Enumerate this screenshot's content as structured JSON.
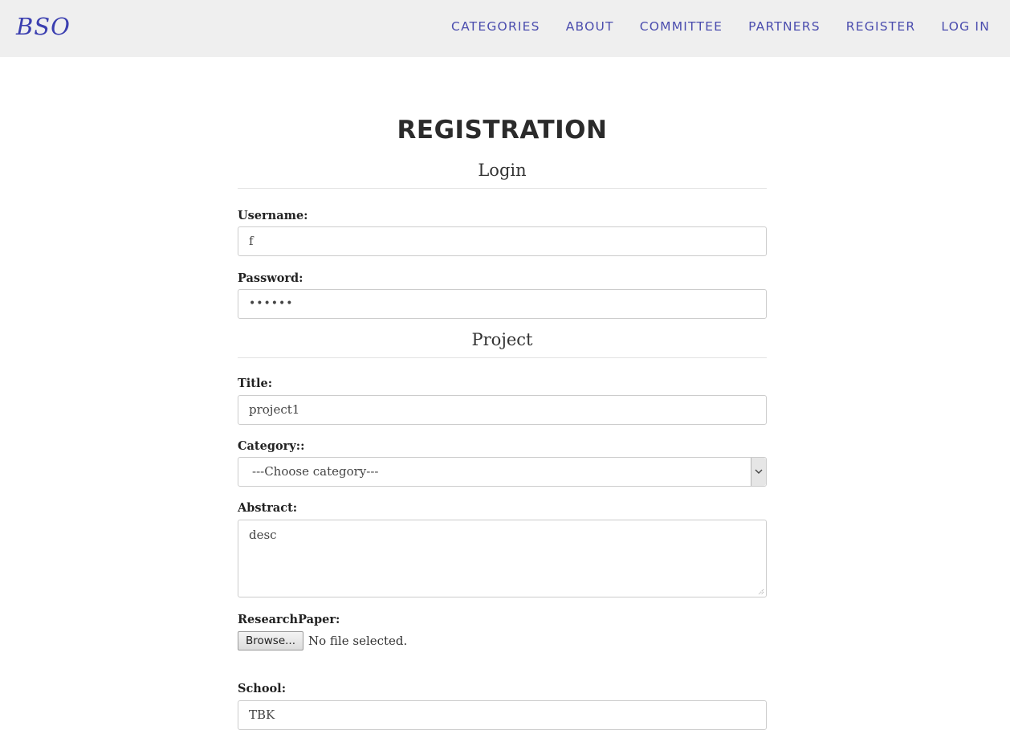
{
  "brand": "BSO",
  "nav": {
    "items": [
      "CATEGORIES",
      "ABOUT",
      "COMMITTEE",
      "PARTNERS",
      "REGISTER",
      "LOG IN"
    ]
  },
  "page_title": "REGISTRATION",
  "sections": {
    "login": "Login",
    "project": "Project"
  },
  "fields": {
    "username": {
      "label": "Username:",
      "value": "f"
    },
    "password": {
      "label": "Password:",
      "value": "••••••"
    },
    "title": {
      "label": "Title:",
      "value": "project1"
    },
    "category": {
      "label": "Category::",
      "selected": "---Choose category---"
    },
    "abstract": {
      "label": "Abstract:",
      "value": "desc"
    },
    "research_paper": {
      "label": "ResearchPaper:",
      "button": "Browse...",
      "status": "No file selected."
    },
    "school": {
      "label": "School:",
      "value": "TBK"
    }
  },
  "colors": {
    "nav_bg": "#efefef",
    "nav_link": "#4b4dae",
    "brand": "#3b3fb0"
  },
  "icons": {
    "select_arrow": "chevron-down-icon",
    "resize": "resize-grip-icon"
  }
}
